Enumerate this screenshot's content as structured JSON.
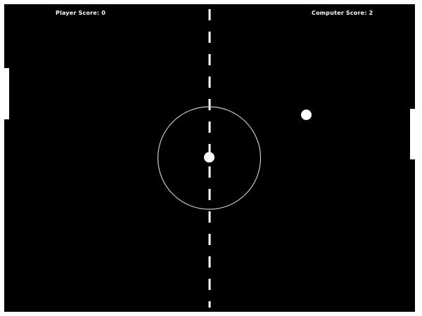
{
  "scoreboard": {
    "player_label": "Player Score: 0",
    "computer_label": "Computer Score: 2"
  },
  "state": {
    "player_score": 0,
    "computer_score": 2
  },
  "colors": {
    "frame": "#ffffff",
    "court": "#000000",
    "foreground": "#ffffff",
    "center_circle": "#c8c8c8"
  }
}
